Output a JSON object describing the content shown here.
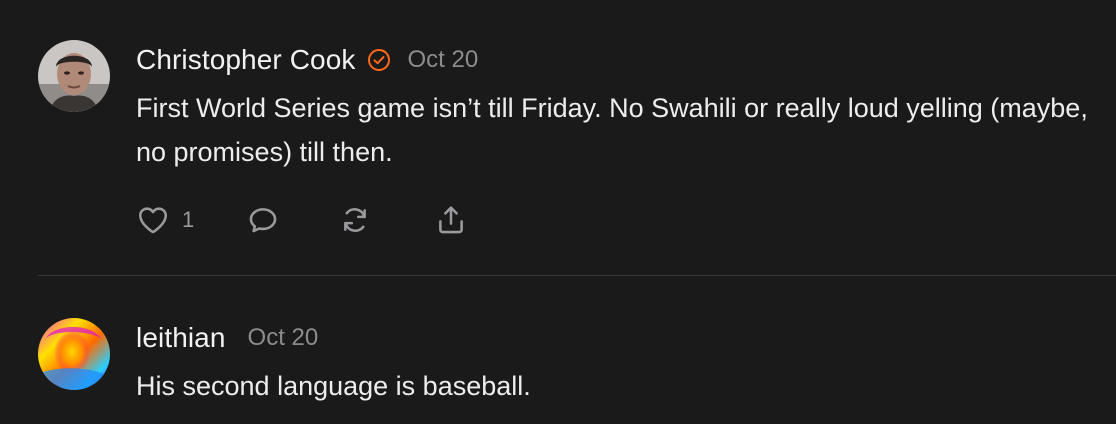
{
  "comments": [
    {
      "author": "Christopher Cook",
      "verified": true,
      "date": "Oct 20",
      "text": "First World Series game isn’t till Friday. No Swahili or really loud yelling (maybe, no promises) till then.",
      "like_count": "1",
      "avatar": "avatar-photo-man",
      "icons": {
        "like": "heart-icon",
        "reply": "comment-bubble-icon",
        "restack": "restack-icon",
        "share": "share-icon"
      }
    },
    {
      "author": "leithian",
      "verified": false,
      "date": "Oct 20",
      "text": "His second language is baseball.",
      "avatar": "avatar-colorful-portrait"
    }
  ],
  "colors": {
    "background": "#1a1a1b",
    "text": "#ededed",
    "muted": "#8c8c8f",
    "verified_badge": "#ff6719",
    "divider": "#38383a"
  }
}
